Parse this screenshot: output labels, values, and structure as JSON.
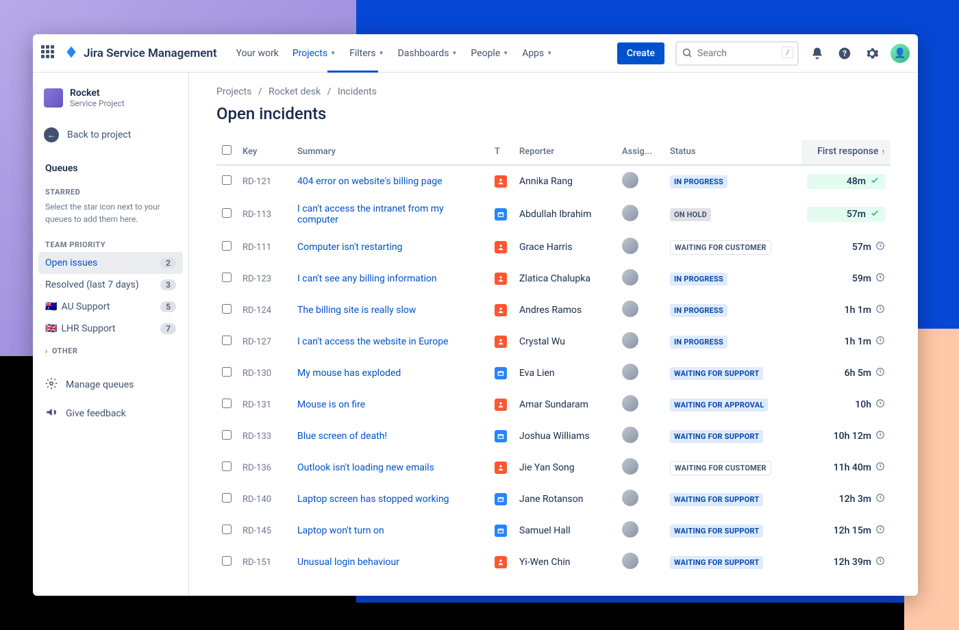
{
  "topnav": {
    "product_name": "Jira Service Management",
    "items": [
      "Your work",
      "Projects",
      "Filters",
      "Dashboards",
      "People",
      "Apps"
    ],
    "active_index": 1,
    "create_label": "Create",
    "search_placeholder": "Search",
    "search_shortcut": "/"
  },
  "sidebar": {
    "project_name": "Rocket",
    "project_type": "Service Project",
    "back_label": "Back to project",
    "queues_title": "Queues",
    "starred_label": "STARRED",
    "starred_help": "Select the star icon next to your queues to add them here.",
    "team_priority_label": "TEAM PRIORITY",
    "queues": [
      {
        "label": "Open issues",
        "count": "2",
        "active": true
      },
      {
        "label": "Resolved (last 7 days)",
        "count": "3"
      },
      {
        "label": "AU Support",
        "count": "5",
        "flag": "🇦🇺"
      },
      {
        "label": "LHR Support",
        "count": "7",
        "flag": "🇬🇧"
      }
    ],
    "other_label": "OTHER",
    "manage_label": "Manage queues",
    "feedback_label": "Give feedback"
  },
  "breadcrumb": {
    "parts": [
      "Projects",
      "Rocket desk",
      "Incidents"
    ]
  },
  "page_title": "Open incidents",
  "columns": {
    "key": "Key",
    "summary": "Summary",
    "type": "T",
    "reporter": "Reporter",
    "assignee": "Assig...",
    "status": "Status",
    "first_response": "First response"
  },
  "rows": [
    {
      "key": "RD-121",
      "summary": "404 error on website's billing page",
      "type": "incident",
      "reporter": "Annika Rang",
      "status": "IN PROGRESS",
      "status_kind": "inprogress",
      "resp": "48m",
      "resp_ok": true
    },
    {
      "key": "RD-113",
      "summary": "I can't access the intranet from my computer",
      "type": "service",
      "reporter": "Abdullah Ibrahim",
      "status": "ON HOLD",
      "status_kind": "onhold",
      "resp": "57m",
      "resp_ok": true
    },
    {
      "key": "RD-111",
      "summary": "Computer isn't restarting",
      "type": "incident",
      "reporter": "Grace Harris",
      "status": "WAITING FOR CUSTOMER",
      "status_kind": "waitingcustomer",
      "resp": "57m",
      "resp_ok": false
    },
    {
      "key": "RD-123",
      "summary": "I can't see any billing information",
      "type": "incident",
      "reporter": "Zlatica Chalupka",
      "status": "IN PROGRESS",
      "status_kind": "inprogress",
      "resp": "59m",
      "resp_ok": false
    },
    {
      "key": "RD-124",
      "summary": "The billing site is really slow",
      "type": "incident",
      "reporter": "Andres Ramos",
      "status": "IN PROGRESS",
      "status_kind": "inprogress",
      "resp": "1h 1m",
      "resp_ok": false
    },
    {
      "key": "RD-127",
      "summary": "I can't access the website in Europe",
      "type": "incident",
      "reporter": "Crystal Wu",
      "status": "IN PROGRESS",
      "status_kind": "inprogress",
      "resp": "1h 1m",
      "resp_ok": false
    },
    {
      "key": "RD-130",
      "summary": "My mouse has exploded",
      "type": "service",
      "reporter": "Eva Lien",
      "status": "WAITING FOR SUPPORT",
      "status_kind": "waitingsupport",
      "resp": "6h 5m",
      "resp_ok": false
    },
    {
      "key": "RD-131",
      "summary": "Mouse is on fire",
      "type": "incident",
      "reporter": "Amar Sundaram",
      "status": "WAITING FOR APPROVAL",
      "status_kind": "waitingapproval",
      "resp": "10h",
      "resp_ok": false
    },
    {
      "key": "RD-133",
      "summary": "Blue screen of death!",
      "type": "service",
      "reporter": "Joshua Williams",
      "status": "WAITING FOR SUPPORT",
      "status_kind": "waitingsupport",
      "resp": "10h 12m",
      "resp_ok": false
    },
    {
      "key": "RD-136",
      "summary": "Outlook isn't loading new emails",
      "type": "incident",
      "reporter": "Jie Yan Song",
      "status": "WAITING FOR CUSTOMER",
      "status_kind": "waitingcustomer",
      "resp": "11h 40m",
      "resp_ok": false
    },
    {
      "key": "RD-140",
      "summary": "Laptop screen has stopped working",
      "type": "service",
      "reporter": "Jane Rotanson",
      "status": "WAITING FOR SUPPORT",
      "status_kind": "waitingsupport",
      "resp": "12h 3m",
      "resp_ok": false
    },
    {
      "key": "RD-145",
      "summary": "Laptop won't turn on",
      "type": "service",
      "reporter": "Samuel Hall",
      "status": "WAITING FOR SUPPORT",
      "status_kind": "waitingsupport",
      "resp": "12h 15m",
      "resp_ok": false
    },
    {
      "key": "RD-151",
      "summary": "Unusual login behaviour",
      "type": "incident",
      "reporter": "Yi-Wen Chin",
      "status": "WAITING FOR SUPPORT",
      "status_kind": "waitingsupport",
      "resp": "12h 39m",
      "resp_ok": false
    }
  ]
}
